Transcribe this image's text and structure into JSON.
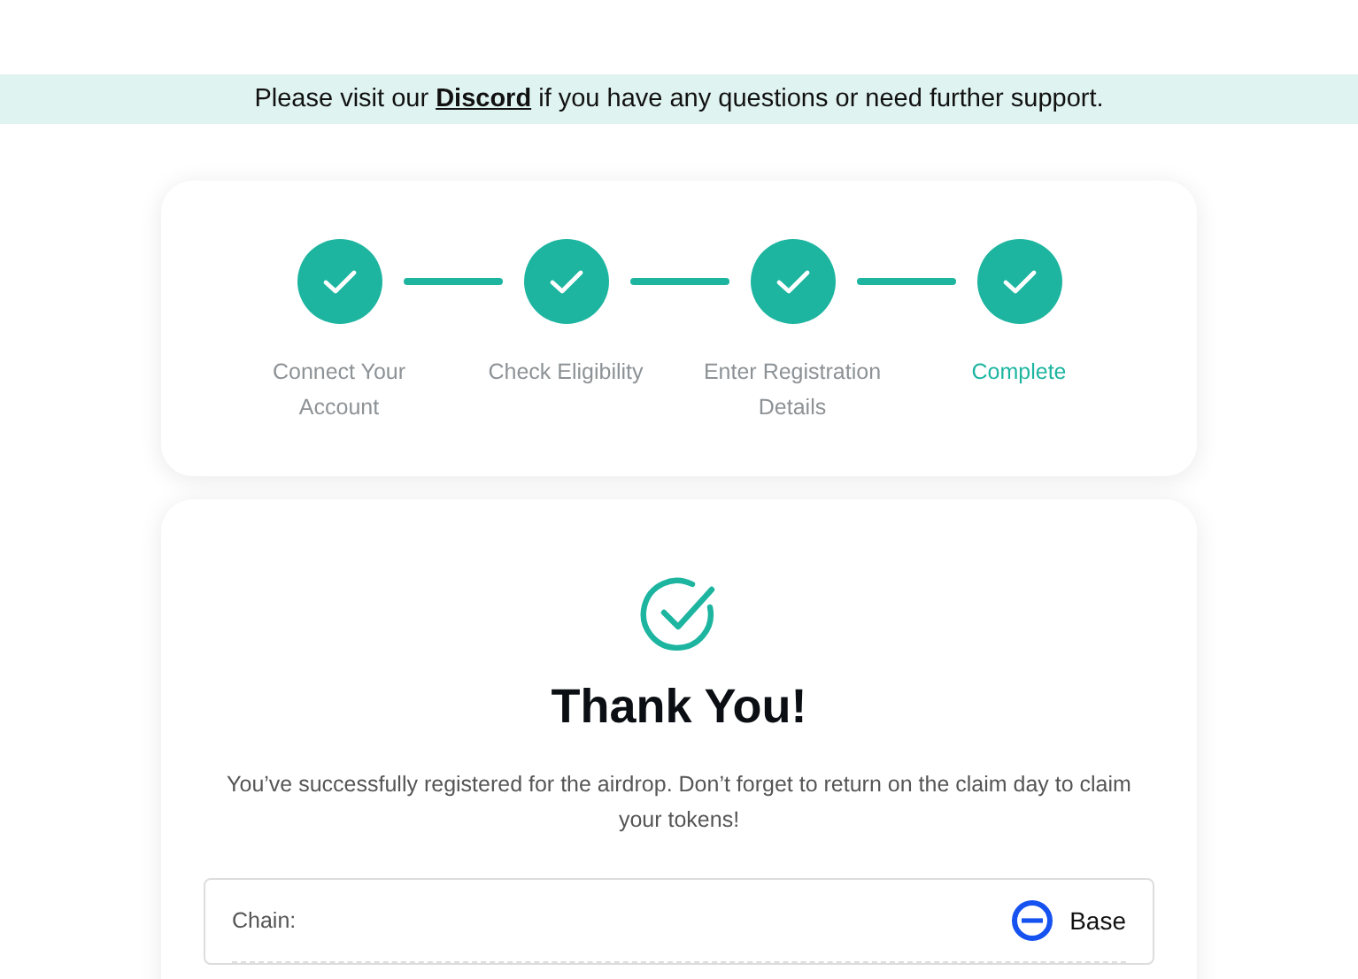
{
  "banner": {
    "before": "Please visit our",
    "link": "Discord",
    "after": "if you have any questions or need further support."
  },
  "steps": [
    {
      "label": "Connect Your Account",
      "done": true,
      "selected": false
    },
    {
      "label": "Check Eligibility",
      "done": true,
      "selected": false
    },
    {
      "label": "Enter Registration Details",
      "done": true,
      "selected": false
    },
    {
      "label": "Complete",
      "done": true,
      "selected": true
    }
  ],
  "result": {
    "title": "Thank You!",
    "message": "You’ve successfully registered for the airdrop. Don’t forget to return on the claim day to claim your tokens!"
  },
  "details": [
    {
      "label": "Chain:",
      "value": "Base"
    }
  ]
}
